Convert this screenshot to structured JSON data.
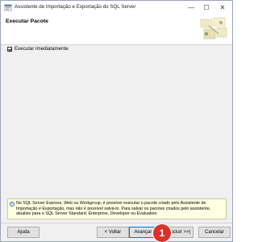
{
  "window": {
    "title": "Assistente de Importação e Exportação do SQL Server",
    "minimize": "—",
    "maximize": "☐",
    "close": "✕"
  },
  "header": {
    "title": "Executar Pacote"
  },
  "options": {
    "run_immediately_label": "Executar imediatamente"
  },
  "info": {
    "text": "No SQL Server Express, Web ou Workgroup, é possível executar o pacote criado pelo Assistente de Importação e Exportação, mas não é possível salvá-lo. Para salvar os pacotes criados pelo assistente, atualize para o SQL Server Standard, Enterprise, Developer ou Evaluation."
  },
  "buttons": {
    "help": "Ajuda",
    "back": "< Voltar",
    "next": "Avançar >",
    "finish": "Concluir >>|",
    "cancel": "Cancelar"
  },
  "annotation": {
    "number": "1",
    "color": "#d9322b"
  }
}
